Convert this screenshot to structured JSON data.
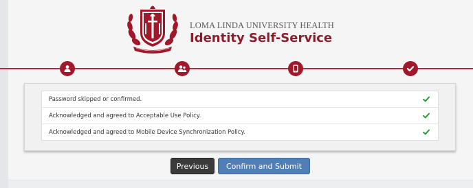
{
  "header": {
    "org_name": "LOMA LINDA UNIVERSITY HEALTH",
    "app_name": "Identity Self-Service",
    "seal_motto": "TO MAKE MAN WHOLE"
  },
  "stepper": {
    "steps": [
      {
        "icon": "user-icon",
        "state": "complete"
      },
      {
        "icon": "users-icon",
        "state": "complete"
      },
      {
        "icon": "mobile-device-icon",
        "state": "complete"
      },
      {
        "icon": "check-icon",
        "state": "current"
      }
    ]
  },
  "confirmations": [
    {
      "text": "Password skipped or confirmed.",
      "status": "check-icon"
    },
    {
      "text": "Acknowledged and agreed to Acceptable Use Policy.",
      "status": "check-icon"
    },
    {
      "text": "Acknowledged and agreed to Mobile Device Synchronization Policy.",
      "status": "check-icon"
    }
  ],
  "buttons": {
    "previous": "Previous",
    "submit": "Confirm and Submit"
  },
  "colors": {
    "brand": "#a1182a",
    "brand_text": "#8a1e2b",
    "check": "#2e9e3a",
    "submit": "#4f7fb6",
    "previous": "#3a3a3a"
  }
}
